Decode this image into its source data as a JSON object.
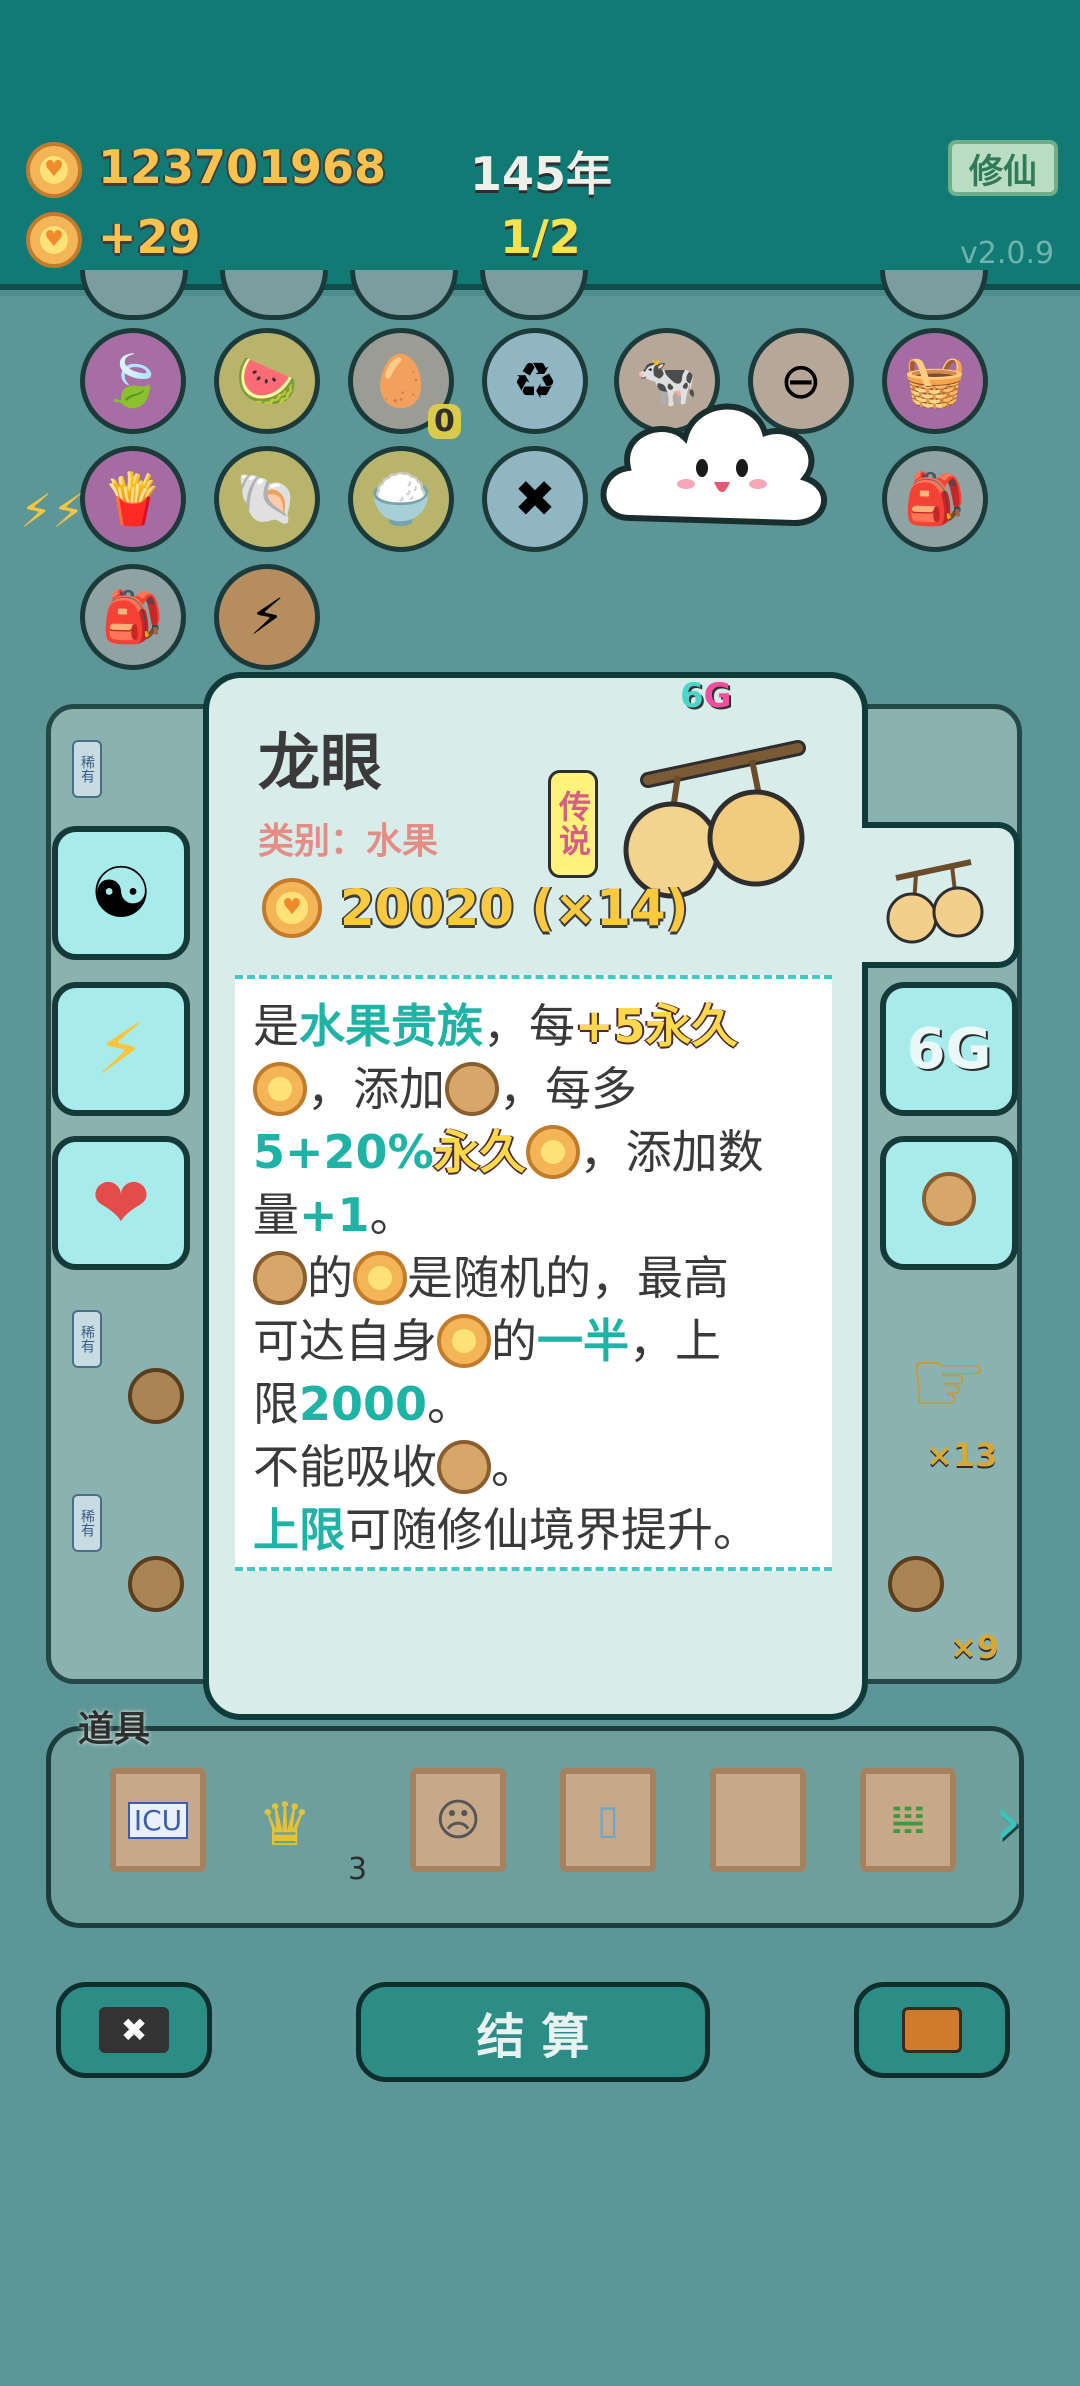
{
  "header": {
    "coins_total": "123701968",
    "coins_delta": "+29",
    "years": "145年",
    "progress": "1/2",
    "cultivate_label": "修仙",
    "version": "v2.0.9"
  },
  "grid_icons": [
    "leaf",
    "fruit-platter",
    "egg-tray",
    "recycle",
    "cows",
    "minus",
    "fruit-basket",
    "fries",
    "shell",
    "rice-bowl",
    "chopsticks",
    "",
    "",
    "sack",
    "sack",
    "lightning"
  ],
  "grid_badges": {
    "egg_tray_count": "0"
  },
  "card": {
    "name": "龙眼",
    "category": "类别：水果",
    "rarity": "传说",
    "tag_six": "6",
    "tag_g": "G",
    "price": "20020 (×14)",
    "desc": {
      "l1a": "是",
      "l1b": "水果贵族",
      "l1c": "，每",
      "l1d": "+5永久",
      "l2a": "，添加",
      "l2b": "，每多",
      "l3a": "5+20%",
      "l3b": "永久",
      "l3c": "，添加数",
      "l4a": "量",
      "l4b": "+1",
      "l4c": "。",
      "l5a": "的",
      "l5b": "是随机的，最高",
      "l6a": "可达自身",
      "l6b": "的",
      "l6c": "一半",
      "l6d": "，上",
      "l7a": "限",
      "l7b": "2000",
      "l7c": "。",
      "l8a": "不能吸收",
      "l8b": "。",
      "l9a": "上限",
      "l9b": "可随修仙境界提升。"
    }
  },
  "side_left": [
    "yin-yang",
    "lightning",
    "liver"
  ],
  "side_right": {
    "six_g": "6G"
  },
  "rows": {
    "rare_tag": "稀有",
    "mult_13": "×13",
    "mult_9": "×9"
  },
  "props": {
    "label": "道具",
    "items": [
      "ICU",
      "crown",
      "robot",
      "fridge",
      "blank",
      "bamboo"
    ],
    "crown_count": "3",
    "icu_text": "ICU"
  },
  "actions": {
    "settle_label": "结 算"
  },
  "colors": {
    "accent": "#127a74",
    "coin": "#f3b557",
    "teal_text": "#1fb3a6",
    "gold_text": "#ffd84c"
  }
}
